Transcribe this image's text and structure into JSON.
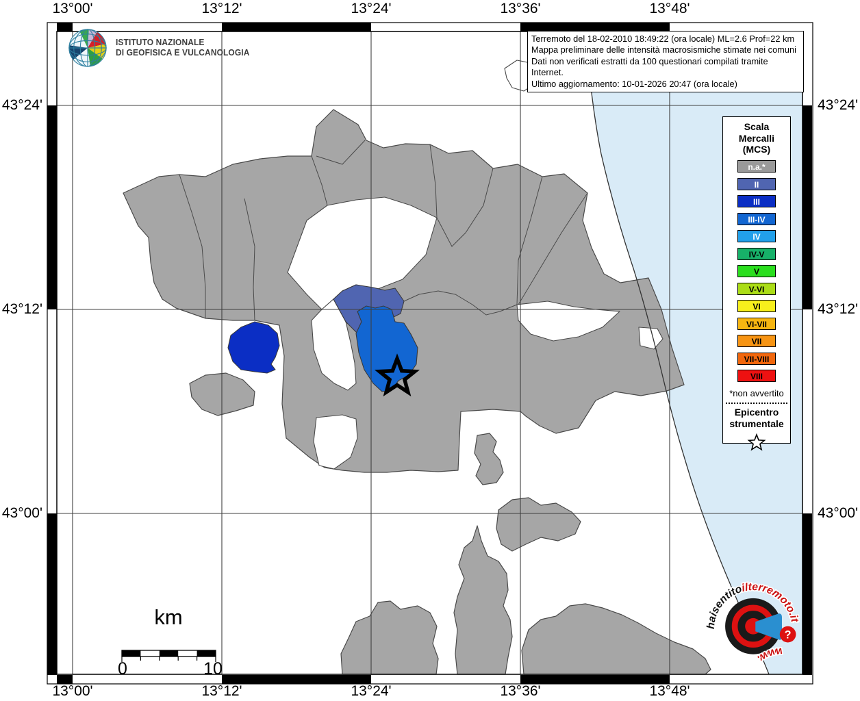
{
  "axes": {
    "top": [
      "13°00'",
      "13°12'",
      "13°24'",
      "13°36'",
      "13°48'"
    ],
    "bottom": [
      "13°00'",
      "13°12'",
      "13°24'",
      "13°36'",
      "13°48'"
    ],
    "left": [
      "43°24'",
      "43°12'",
      "43°00'"
    ],
    "right": [
      "43°24'",
      "43°12'",
      "43°00'"
    ]
  },
  "info_box": {
    "lines": [
      "Terremoto del 18-02-2010 18:49:22 (ora locale) ML=2.6 Prof=22 km",
      "Mappa preliminare delle intensità macrosismiche stimate nei comuni",
      "Dati non verificati estratti da 100 questionari compilati tramite Internet.",
      "Ultimo aggiornamento: 10-01-2026 20:47 (ora locale)"
    ]
  },
  "ingv": {
    "name_line1": "ISTITUTO NAZIONALE",
    "name_line2": "DI GEOFISICA E VULCANOLOGIA"
  },
  "legend": {
    "title_lines": [
      "Scala",
      "Mercalli",
      "(MCS)"
    ],
    "items": [
      {
        "label": "n.a.*",
        "color": "#9a9a9a",
        "text_color": "#ffffff"
      },
      {
        "label": "II",
        "color": "#5065b1",
        "text_color": "#ffffff"
      },
      {
        "label": "III",
        "color": "#0b2ec4",
        "text_color": "#ffffff"
      },
      {
        "label": "III-IV",
        "color": "#1266d2",
        "text_color": "#ffffff"
      },
      {
        "label": "IV",
        "color": "#22a0ea",
        "text_color": "#ffffff"
      },
      {
        "label": "IV-V",
        "color": "#17b169",
        "text_color": "#000000"
      },
      {
        "label": "V",
        "color": "#2ade1e",
        "text_color": "#000000"
      },
      {
        "label": "V-VI",
        "color": "#abdd17",
        "text_color": "#000000"
      },
      {
        "label": "VI",
        "color": "#f7ef1c",
        "text_color": "#000000"
      },
      {
        "label": "VI-VII",
        "color": "#f6b511",
        "text_color": "#000000"
      },
      {
        "label": "VII",
        "color": "#f79413",
        "text_color": "#000000"
      },
      {
        "label": "VII-VIII",
        "color": "#f1670d",
        "text_color": "#000000"
      },
      {
        "label": "VIII",
        "color": "#ee1111",
        "text_color": "#000000"
      }
    ],
    "footnote": "*non avvertito",
    "epicenter_lines": [
      "Epicentro",
      "strumentale"
    ]
  },
  "scale_bar": {
    "unit": "km",
    "start": "0",
    "end": "10"
  },
  "watermark": {
    "arc_black": "haisentito",
    "arc_red": "ilterremoto.it",
    "bottom_red": "www.",
    "question_mark": "?"
  },
  "map": {
    "sea_color": "#d9ebf7",
    "land_color": "#a6a6a6",
    "boundary_color": "#4a4a4a",
    "intensities_on_map": [
      {
        "level": "II",
        "color": "#5065b1"
      },
      {
        "level": "III",
        "color": "#0b2ec4"
      },
      {
        "level": "III-IV",
        "color": "#1266d2"
      }
    ]
  }
}
